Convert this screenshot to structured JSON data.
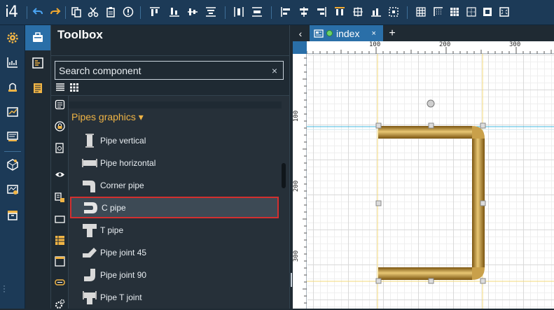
{
  "app": {
    "logo": "i4"
  },
  "toolbar": {
    "buttons": [
      "undo-icon",
      "redo-icon",
      "copy-icon",
      "cut-icon",
      "paste-icon",
      "info-icon",
      "align-top-icon",
      "align-bottom-icon",
      "align-middle-icon",
      "align-vertical-center-icon",
      "distribute-horizontal-icon",
      "distribute-vertical-icon",
      "align-left-icon",
      "align-center-icon",
      "align-right-icon",
      "align-top-edge-icon",
      "align-center-vertical-icon",
      "align-bottom-edge-icon",
      "same-size-icon",
      "grid-icon",
      "snap-icon",
      "grid-fine-icon",
      "fit-icon",
      "snap-grid-icon",
      "fullscreen-icon"
    ]
  },
  "leftrail": {
    "items": [
      "settings-icon",
      "charts-icon",
      "alarm-icon",
      "trends-icon",
      "report-icon",
      "package-icon",
      "diagnostics-icon",
      "archive-icon"
    ]
  },
  "sidetabs": {
    "items": [
      "toolbox-icon",
      "components-icon",
      "pages-icon"
    ]
  },
  "toolbox": {
    "title": "Toolbox",
    "search_text": "Search component",
    "clear": "×",
    "group_header": "Pipes graphics ▾",
    "categories": [
      "list-icon",
      "lock-icon",
      "document-icon",
      "eye-icon",
      "flow-icon",
      "window-icon",
      "table-icon",
      "frame-icon",
      "link-icon",
      "gear-icon"
    ],
    "items": [
      {
        "label": "Pipe vertical",
        "icon": "pipe-vertical-icon"
      },
      {
        "label": "Pipe horizontal",
        "icon": "pipe-horizontal-icon"
      },
      {
        "label": "Corner pipe",
        "icon": "corner-pipe-icon"
      },
      {
        "label": "C pipe",
        "icon": "c-pipe-icon",
        "selected": true
      },
      {
        "label": "T pipe",
        "icon": "t-pipe-icon"
      },
      {
        "label": "Pipe joint 45",
        "icon": "pipe-joint-45-icon"
      },
      {
        "label": "Pipe joint 90",
        "icon": "pipe-joint-90-icon"
      },
      {
        "label": "Pipe T joint",
        "icon": "pipe-t-joint-icon"
      }
    ]
  },
  "editor": {
    "back": "‹",
    "tab_label": "index",
    "tab_close": "×",
    "tab_add": "+",
    "ruler_top": [
      "100",
      "200",
      "300"
    ],
    "ruler_left": [
      "100",
      "200",
      "300"
    ]
  },
  "colors": {
    "accent": "#2a6fa8",
    "selection_border": "#d32f2f",
    "group_header": "#f0b445",
    "pipe": "#b8862a"
  }
}
